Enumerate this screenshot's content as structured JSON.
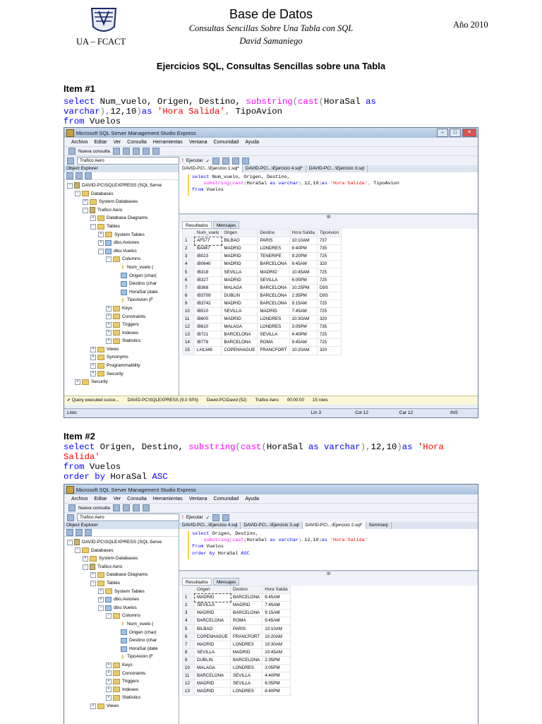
{
  "header": {
    "logo_text": "UA – FCACT",
    "title": "Base de Datos",
    "subtitle": "Consultas Sencillas Sobre Una Tabla con SQL",
    "author": "David Samaniego",
    "year": "Año 2010"
  },
  "doc_title": "Ejercicios SQL, Consultas Sencillas sobre una Tabla",
  "item1": {
    "heading": "Item #1",
    "sql_lines": [
      [
        [
          "kw",
          "select "
        ],
        [
          "pl",
          "Num_vuelo, Origen, Destino, "
        ],
        [
          "fn",
          "substring"
        ],
        [
          "gr",
          "("
        ],
        [
          "fn",
          "cast"
        ],
        [
          "gr",
          "("
        ],
        [
          "pl",
          "HoraSal "
        ],
        [
          "kw",
          "as"
        ]
      ],
      [
        [
          "kw",
          "varchar"
        ],
        [
          "gr",
          "),"
        ],
        [
          "pl",
          "12,10"
        ],
        [
          "gr",
          ")"
        ],
        [
          "kw",
          "as "
        ],
        [
          "str",
          "'Hora Salida'"
        ],
        [
          "gr",
          ", "
        ],
        [
          "pl",
          "TipoAvion"
        ]
      ],
      [
        [
          "kw",
          "from "
        ],
        [
          "pl",
          "Vuelos"
        ]
      ]
    ]
  },
  "item2": {
    "heading": "Item #2",
    "sql_lines": [
      [
        [
          "kw",
          "select "
        ],
        [
          "pl",
          "Origen, Destino, "
        ],
        [
          "fn",
          "substring"
        ],
        [
          "gr",
          "("
        ],
        [
          "fn",
          "cast"
        ],
        [
          "gr",
          "("
        ],
        [
          "pl",
          "HoraSal "
        ],
        [
          "kw",
          "as varchar"
        ],
        [
          "gr",
          "),"
        ],
        [
          "pl",
          "12,10"
        ],
        [
          "gr",
          ")"
        ],
        [
          "kw",
          "as "
        ],
        [
          "str",
          "'Hora"
        ]
      ],
      [
        [
          "str",
          "Salida'"
        ]
      ],
      [
        [
          "kw",
          "from "
        ],
        [
          "pl",
          "Vuelos"
        ]
      ],
      [
        [
          "kw",
          "order by "
        ],
        [
          "pl",
          "HoraSal "
        ],
        [
          "kw",
          "ASC"
        ]
      ]
    ]
  },
  "ssms": {
    "window_title": "Microsoft SQL Server Management Studio Express",
    "menu": [
      "Archivo",
      "Editar",
      "Ver",
      "Consulta",
      "Herramientas",
      "Ventana",
      "Comunidad",
      "Ayuda"
    ],
    "new_query": "Nueva consulta",
    "database": "Trafico Aero",
    "execute": "Ejecutar",
    "object_explorer": "Object Explorer",
    "tree1": [
      {
        "indent": 0,
        "pm": "-",
        "icon": "server",
        "text": "DAVID-PC\\SQLEXPRESS (SQL Serve"
      },
      {
        "indent": 1,
        "pm": "-",
        "icon": "folder",
        "text": "Databases"
      },
      {
        "indent": 2,
        "pm": "+",
        "icon": "folder",
        "text": "System Databases"
      },
      {
        "indent": 2,
        "pm": "-",
        "icon": "db",
        "text": "Trafico Aero"
      },
      {
        "indent": 3,
        "pm": "+",
        "icon": "folder",
        "text": "Database Diagrams"
      },
      {
        "indent": 3,
        "pm": "-",
        "icon": "folder",
        "text": "Tables"
      },
      {
        "indent": 4,
        "pm": "+",
        "icon": "folder",
        "text": "System Tables"
      },
      {
        "indent": 4,
        "pm": "+",
        "icon": "table",
        "text": "dbo.Aviones"
      },
      {
        "indent": 4,
        "pm": "-",
        "icon": "table",
        "text": "dbo.Vuelos"
      },
      {
        "indent": 5,
        "pm": "-",
        "icon": "folder",
        "text": "Columns"
      },
      {
        "indent": 6,
        "pm": "",
        "icon": "key",
        "text": "Num_vuelo ("
      },
      {
        "indent": 6,
        "pm": "",
        "icon": "col",
        "text": "Origen (char("
      },
      {
        "indent": 6,
        "pm": "",
        "icon": "col",
        "text": "Destino (char"
      },
      {
        "indent": 6,
        "pm": "",
        "icon": "col",
        "text": "HoraSal (date"
      },
      {
        "indent": 6,
        "pm": "",
        "icon": "key",
        "text": "TipoAvion (F"
      },
      {
        "indent": 5,
        "pm": "+",
        "icon": "folder",
        "text": "Keys"
      },
      {
        "indent": 5,
        "pm": "+",
        "icon": "folder",
        "text": "Constraints"
      },
      {
        "indent": 5,
        "pm": "+",
        "icon": "folder",
        "text": "Triggers"
      },
      {
        "indent": 5,
        "pm": "+",
        "icon": "folder",
        "text": "Indexes"
      },
      {
        "indent": 5,
        "pm": "+",
        "icon": "folder",
        "text": "Statistics"
      },
      {
        "indent": 3,
        "pm": "+",
        "icon": "folder",
        "text": "Views"
      },
      {
        "indent": 3,
        "pm": "+",
        "icon": "folder",
        "text": "Synonyms"
      },
      {
        "indent": 3,
        "pm": "+",
        "icon": "folder",
        "text": "Programmability"
      },
      {
        "indent": 3,
        "pm": "+",
        "icon": "folder",
        "text": "Security"
      },
      {
        "indent": 1,
        "pm": "+",
        "icon": "folder",
        "text": "Security"
      }
    ],
    "tree2": [
      {
        "indent": 0,
        "pm": "-",
        "icon": "server",
        "text": "DAVID-PC\\SQLEXPRESS (SQL Serve"
      },
      {
        "indent": 1,
        "pm": "-",
        "icon": "folder",
        "text": "Databases"
      },
      {
        "indent": 2,
        "pm": "+",
        "icon": "folder",
        "text": "System Databases"
      },
      {
        "indent": 2,
        "pm": "-",
        "icon": "db",
        "text": "Trafico Aero"
      },
      {
        "indent": 3,
        "pm": "+",
        "icon": "folder",
        "text": "Database Diagrams"
      },
      {
        "indent": 3,
        "pm": "-",
        "icon": "folder",
        "text": "Tables"
      },
      {
        "indent": 4,
        "pm": "+",
        "icon": "folder",
        "text": "System Tables"
      },
      {
        "indent": 4,
        "pm": "+",
        "icon": "table",
        "text": "dbo.Aviones"
      },
      {
        "indent": 4,
        "pm": "-",
        "icon": "table",
        "text": "dbo.Vuelos"
      },
      {
        "indent": 5,
        "pm": "-",
        "icon": "folder",
        "text": "Columns"
      },
      {
        "indent": 6,
        "pm": "",
        "icon": "key",
        "text": "Num_vuelo ("
      },
      {
        "indent": 6,
        "pm": "",
        "icon": "col",
        "text": "Origen (char("
      },
      {
        "indent": 6,
        "pm": "",
        "icon": "col",
        "text": "Destino (char"
      },
      {
        "indent": 6,
        "pm": "",
        "icon": "col",
        "text": "HoraSal (date"
      },
      {
        "indent": 6,
        "pm": "",
        "icon": "key",
        "text": "TipoAvion (F"
      },
      {
        "indent": 5,
        "pm": "+",
        "icon": "folder",
        "text": "Keys"
      },
      {
        "indent": 5,
        "pm": "+",
        "icon": "folder",
        "text": "Constraints"
      },
      {
        "indent": 5,
        "pm": "+",
        "icon": "folder",
        "text": "Triggers"
      },
      {
        "indent": 5,
        "pm": "+",
        "icon": "folder",
        "text": "Indexes"
      },
      {
        "indent": 5,
        "pm": "+",
        "icon": "folder",
        "text": "Statistics"
      },
      {
        "indent": 3,
        "pm": "+",
        "icon": "folder",
        "text": "Views"
      }
    ],
    "tabs1": [
      "DAVID-PC\\...\\Ejercicio 1.sql*",
      "DAVID-PC\\...\\Ejercicio 4.sql*",
      "DAVID-PC\\...\\Ejercicio 3.sql"
    ],
    "tabs2": [
      "DAVID-PC\\...\\Ejercicio 4.sql",
      "DAVID-PC\\...\\Ejercicio 3.sql",
      "DAVID-PC\\...\\Ejercicio 2.sql*",
      "Summary"
    ],
    "editor1": [
      [
        [
          "kw",
          "select "
        ],
        [
          "pl",
          "Num_vuelo, Origen, Destino,"
        ]
      ],
      [
        [
          "pl",
          "    "
        ],
        [
          "fn",
          "substring"
        ],
        [
          "gr",
          "("
        ],
        [
          "fn",
          "cast"
        ],
        [
          "gr",
          "("
        ],
        [
          "pl",
          "HoraSal "
        ],
        [
          "kw",
          "as varchar"
        ],
        [
          "gr",
          "),"
        ],
        [
          "pl",
          "12,10"
        ],
        [
          "gr",
          ")"
        ],
        [
          "kw",
          "as "
        ],
        [
          "str",
          "'Hora Salida'"
        ],
        [
          "gr",
          ", "
        ],
        [
          "pl",
          "TipoAvion"
        ]
      ],
      [
        [
          "kw",
          "from "
        ],
        [
          "pl",
          "Vuelos"
        ]
      ]
    ],
    "editor2": [
      [
        [
          "kw",
          "select "
        ],
        [
          "pl",
          "Origen, Destino,"
        ]
      ],
      [
        [
          "pl",
          "    "
        ],
        [
          "fn",
          "substring"
        ],
        [
          "gr",
          "("
        ],
        [
          "fn",
          "cast"
        ],
        [
          "gr",
          "("
        ],
        [
          "pl",
          "HoraSal "
        ],
        [
          "kw",
          "as varchar"
        ],
        [
          "gr",
          "),"
        ],
        [
          "pl",
          "12,10"
        ],
        [
          "gr",
          ")"
        ],
        [
          "kw",
          "as "
        ],
        [
          "str",
          "'Hora Salida'"
        ]
      ],
      [
        [
          "kw",
          "from "
        ],
        [
          "pl",
          "Vuelos"
        ]
      ],
      [
        [
          "kw",
          "order by "
        ],
        [
          "pl",
          "HoraSal "
        ],
        [
          "kw",
          "ASC"
        ]
      ]
    ],
    "results_tab": "Resultados",
    "messages_tab": "Mensajes",
    "results1": {
      "columns": [
        "Num_vuelo",
        "Origen",
        "Destino",
        "Hora Salida",
        "TipoAvion"
      ],
      "rows": [
        [
          "AF577",
          "BILBAO",
          "PARIS",
          "10:10AM",
          "737"
        ],
        [
          "BA467",
          "MADRID",
          "LONDRES",
          "8:40PM",
          "735"
        ],
        [
          "IB023",
          "MADRID",
          "TENERIFE",
          "9:20PM",
          "725"
        ],
        [
          "IB0640",
          "MADRID",
          "BARCELONA",
          "6:45AM",
          "320"
        ],
        [
          "IB318",
          "SEVILLA",
          "MADRID",
          "10:45AM",
          "725"
        ],
        [
          "IB327",
          "MADRID",
          "SEVILLA",
          "6:05PM",
          "725"
        ],
        [
          "IB368",
          "MALAGA",
          "BARCELONA",
          "10:25PM",
          "D9S"
        ],
        [
          "IB3709",
          "DUBLIN",
          "BARCELONA",
          "2:35PM",
          "D9S"
        ],
        [
          "IB3742",
          "MADRID",
          "BARCELONA",
          "9:15AM",
          "725"
        ],
        [
          "IB510",
          "SEVILLA",
          "MADRID",
          "7:45AM",
          "725"
        ],
        [
          "IB600",
          "MADRID",
          "LONDRES",
          "10:30AM",
          "320"
        ],
        [
          "IB610",
          "MALAGA",
          "LONDRES",
          "3:05PM",
          "735"
        ],
        [
          "IB721",
          "BARCELONA",
          "SEVILLA",
          "4:40PM",
          "725"
        ],
        [
          "IB778",
          "BARCELONA",
          "ROMA",
          "9:45AM",
          "725"
        ],
        [
          "LH1349",
          "COPENHAGUE",
          "FRANCFORT",
          "10:20AM",
          "320"
        ]
      ]
    },
    "results2": {
      "columns": [
        "Origen",
        "Destino",
        "Hora Salida"
      ],
      "rows": [
        [
          "MADRID",
          "BARCELONA",
          "6:45AM"
        ],
        [
          "SEVILLA",
          "MADRID",
          "7:45AM"
        ],
        [
          "MADRID",
          "BARCELONA",
          "9:15AM"
        ],
        [
          "BARCELONA",
          "ROMA",
          "9:45AM"
        ],
        [
          "BILBAO",
          "PARIS",
          "10:10AM"
        ],
        [
          "COPENHAGUE",
          "FRANCFORT",
          "10:20AM"
        ],
        [
          "MADRID",
          "LONDRES",
          "10:30AM"
        ],
        [
          "SEVILLA",
          "MADRID",
          "10:45AM"
        ],
        [
          "DUBLIN",
          "BARCELONA",
          "2:35PM"
        ],
        [
          "MALAGA",
          "LONDRES",
          "3:05PM"
        ],
        [
          "BARCELONA",
          "SEVILLA",
          "4:40PM"
        ],
        [
          "MADRID",
          "SEVILLA",
          "6:05PM"
        ],
        [
          "MADRID",
          "LONDRES",
          "8:40PM"
        ]
      ]
    },
    "status1": [
      "Query executed succe...",
      "DAVID-PC\\SQLEXPRESS (9.0 SP3)",
      "David-PC\\David (52)",
      "Trafico Aero",
      "00:00:00",
      "15 rows"
    ],
    "bottom1": [
      "Listo",
      "Lín 3",
      "Col 12",
      "Car 12",
      "INS"
    ]
  }
}
